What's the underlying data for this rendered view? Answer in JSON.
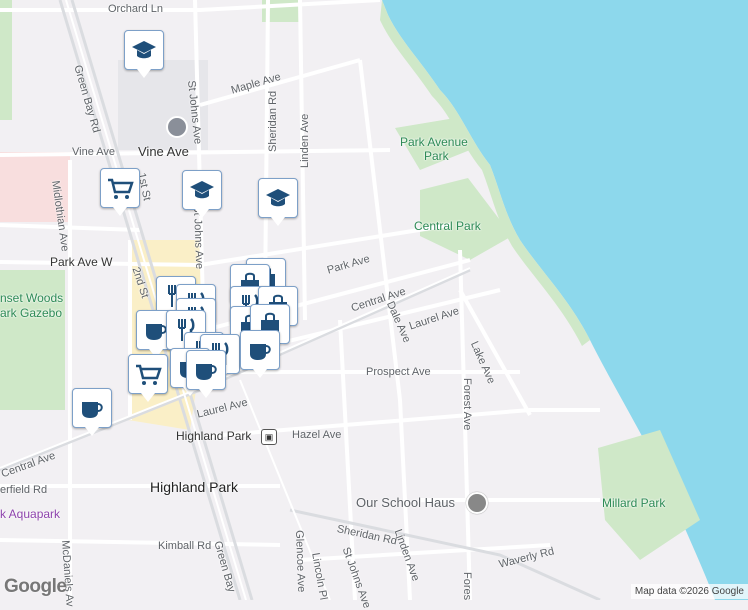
{
  "map": {
    "colors": {
      "land": "#f2f0f3",
      "water": "#8dd8ec",
      "park": "#cfe8c8",
      "road": "#ffffff",
      "road_major": "#dadce0",
      "commercial": "#faefc7",
      "pink": "#f8dede"
    },
    "streets": {
      "orchard": "Orchard Ln",
      "maple": "Maple Ave",
      "st_johns_n": "St Johns Ave",
      "sheridan_n": "Sheridan Rd",
      "linden_n": "Linden Ave",
      "vine_w": "Vine Ave",
      "vine": "Vine Ave",
      "midlothian": "Midlothian Ave",
      "first": "1st St",
      "st_johns_mid": "St Johns Ave",
      "park_w": "Park Ave W",
      "park": "Park Ave",
      "second": "2nd St",
      "central": "Central Ave",
      "central_w": "Central Ave",
      "dale": "Dale Ave",
      "laurel": "Laurel Ave",
      "lake": "Lake Ave",
      "prospect": "Prospect Ave",
      "forest": "Forest Ave",
      "laurel_w": "Laurel Ave",
      "hazel": "Hazel Ave",
      "deerfield": "erfield Rd",
      "kimball": "Kimball Rd",
      "mcdaniels": "McDaniels Av",
      "green_bay_n": "Green Bay Rd",
      "green_bay_s": "Green Bay",
      "glencoe": "Glencoe Ave",
      "lincoln": "Lincoln Pl",
      "st_johns_s": "St Johns Ave",
      "sheridan_s": "Sheridan Rd",
      "linden_s": "Linden Ave",
      "waverly": "Waverly Rd",
      "forest_s": "Fores"
    },
    "parks": {
      "park_avenue_1": "Park Avenue",
      "park_avenue_2": "Park",
      "central": "Central Park",
      "millard": "Millard Park",
      "sunset_1": "nset Woods",
      "sunset_2": "ark Gazebo",
      "aquapark": "k Aquapark"
    },
    "places": {
      "town": "Highland Park",
      "station": "Highland Park",
      "school": "Our School Haus"
    },
    "icons": {
      "school": "school-icon",
      "shopping_cart": "shopping-cart-icon",
      "restaurant": "fork-knife-icon",
      "coffee": "coffee-cup-icon",
      "shopping_bag": "shopping-bag-icon",
      "train": "train-icon",
      "place": "place-pin-icon"
    },
    "attribution": "Map data ©2026 Google",
    "logo": "Google"
  }
}
